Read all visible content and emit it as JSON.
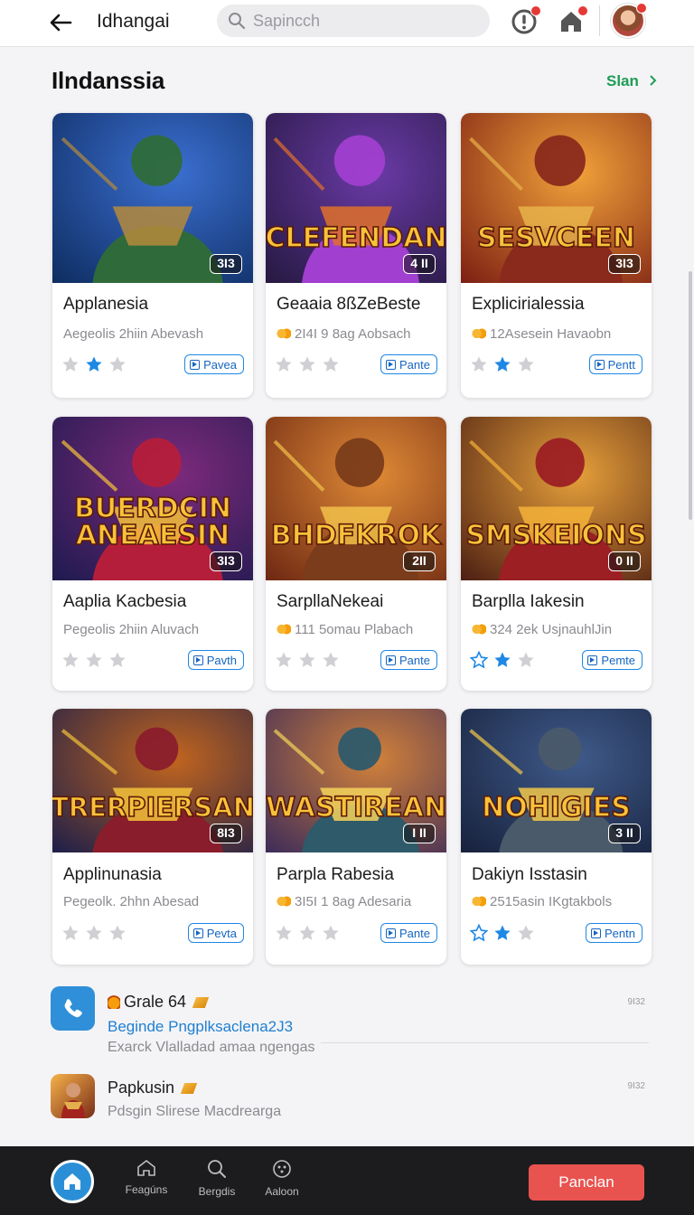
{
  "header": {
    "title": "Idhangai",
    "search_placeholder": "Sapincch",
    "icons": [
      "back-arrow-icon",
      "alert-icon",
      "home-icon",
      "avatar"
    ]
  },
  "section": {
    "title": "Ilndanssia",
    "see_all": "Slan"
  },
  "cards": [
    {
      "title": "Applanesia",
      "subtitle": "Aegeolis 2hiin Abevash",
      "coin": false,
      "badge": "3I3",
      "banner": "",
      "button": "Pavea",
      "stars": [
        "gray",
        "blue",
        "gray"
      ]
    },
    {
      "title": "Geaaia 8ßZeBeste",
      "subtitle": "2I4I 9 8ag Aobsach",
      "coin": true,
      "badge": "4 II",
      "banner": "CLEFENDAN",
      "button": "Pante",
      "stars": [
        "gray",
        "gray",
        "gray"
      ]
    },
    {
      "title": "Explicirialessia",
      "subtitle": "12Asesein Havaobn",
      "coin": true,
      "badge": "3I3",
      "banner": "SESVCEEN",
      "button": "Pentt",
      "stars": [
        "gray",
        "blue",
        "gray"
      ]
    },
    {
      "title": "Aaplia Kacbesia",
      "subtitle": "Pegeolis 2hiin Aluvach",
      "coin": false,
      "badge": "3I3",
      "banner": "BUERDCIN ANEAESIN",
      "button": "Pavth",
      "stars": [
        "gray",
        "gray",
        "gray"
      ]
    },
    {
      "title": "SarpllaNekeai",
      "subtitle": "111 5omau Plabach",
      "coin": true,
      "badge": "2II",
      "banner": "BHDFKROK",
      "button": "Pante",
      "stars": [
        "gray",
        "gray",
        "gray"
      ]
    },
    {
      "title": "Barplla Iakesin",
      "subtitle": "324 2ek UsjnauhlJin",
      "coin": true,
      "badge": "0 II",
      "banner": "SMSKEIONS",
      "button": "Pemte",
      "stars": [
        "outline",
        "blue",
        "gray"
      ]
    },
    {
      "title": "Applinunasia",
      "subtitle": "Pegeolk. 2hhn Abesad",
      "coin": false,
      "badge": "8I3",
      "banner": "TRERPIERSAN",
      "button": "Pevta",
      "stars": [
        "gray",
        "gray",
        "gray"
      ]
    },
    {
      "title": "Parpla Rabesia",
      "subtitle": "3I5I 1 8ag Adesaria",
      "coin": true,
      "badge": "I II",
      "banner": "WASTIREAN",
      "button": "Pante",
      "stars": [
        "gray",
        "gray",
        "gray"
      ]
    },
    {
      "title": "Dakiyn Isstasin",
      "subtitle": "2515asin IKgtakbols",
      "coin": true,
      "badge": "3 II",
      "banner": "NOHIGIES",
      "button": "Pentn",
      "stars": [
        "outline",
        "blue",
        "gray"
      ]
    }
  ],
  "list": [
    {
      "title": "Grale 64",
      "link": "Beginde Pngplksaclena2J3",
      "desc": "Exarck Vlalladad amaa ngengas",
      "time": "9I32"
    },
    {
      "title": "Papkusin",
      "link": "",
      "desc": "Pdsgin Slirese Macdrearga",
      "time": "9I32"
    }
  ],
  "bottom_nav": {
    "items": [
      {
        "label": "Feagúns",
        "icon": "home-outline-icon"
      },
      {
        "label": "Bergdis",
        "icon": "search-icon"
      },
      {
        "label": "Aaloon",
        "icon": "dots-circle-icon"
      }
    ],
    "cta": "Panclan"
  },
  "colors": {
    "accent_green": "#1f9d55",
    "accent_blue": "#1e88e5",
    "cta_red": "#e8534f",
    "bottom_bar": "#1c1c1e"
  }
}
